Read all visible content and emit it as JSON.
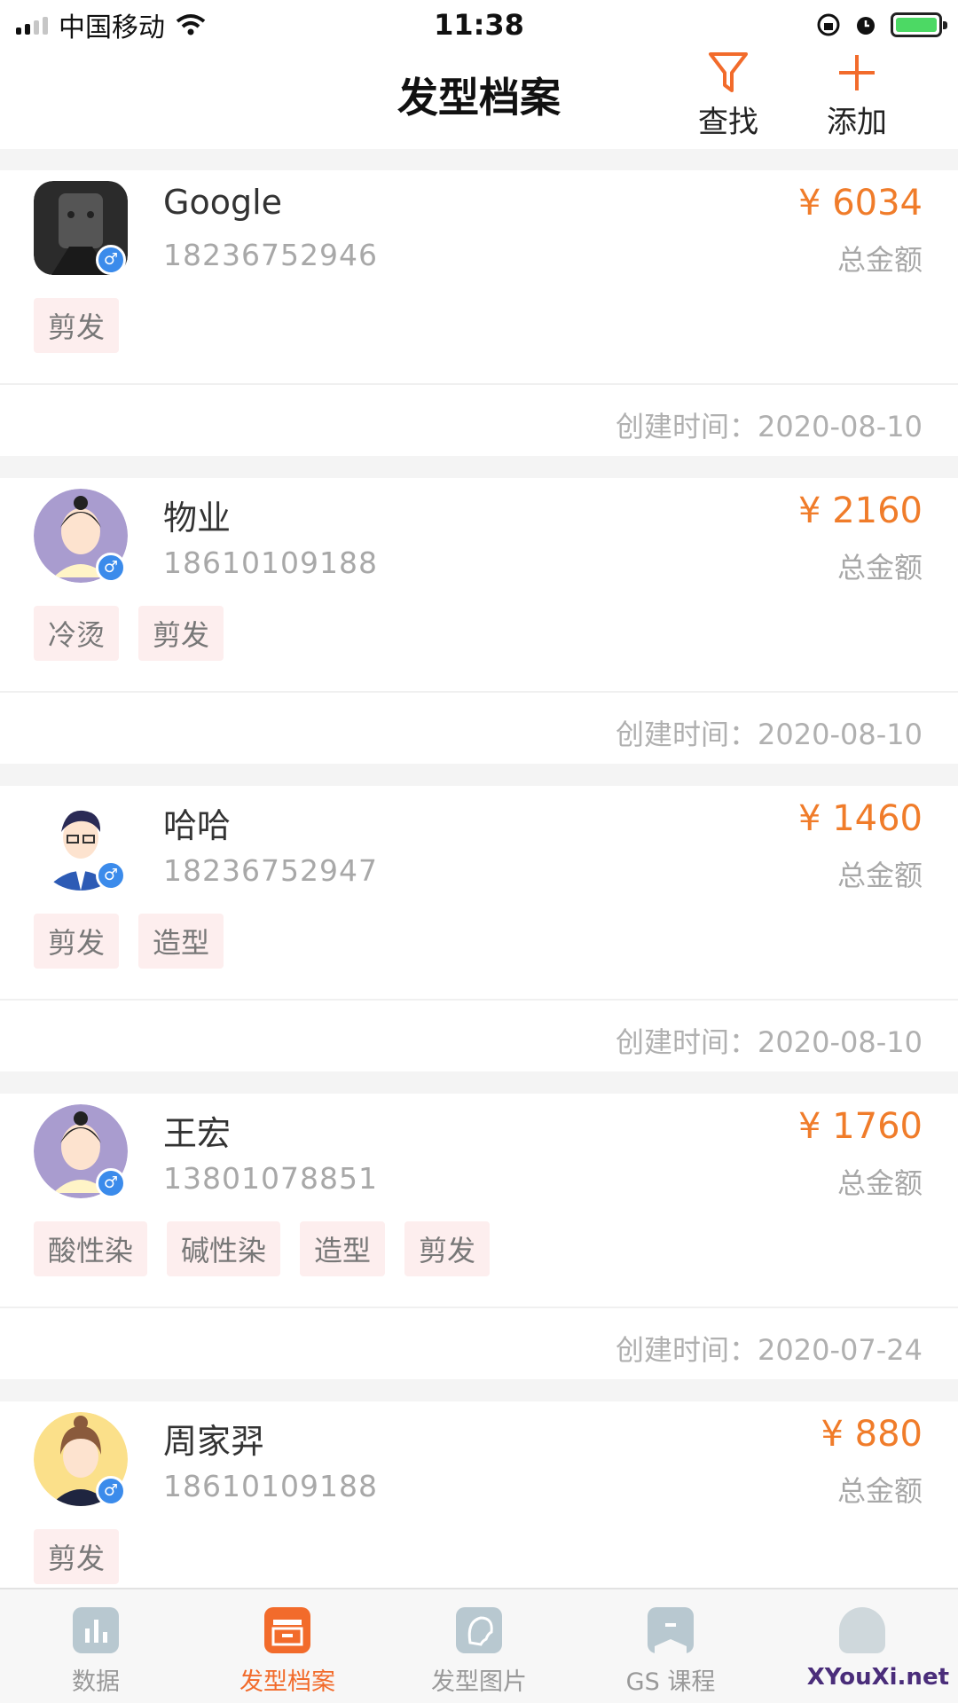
{
  "status": {
    "carrier": "中国移动",
    "time": "11:38"
  },
  "header": {
    "title": "发型档案",
    "find_label": "查找",
    "add_label": "添加"
  },
  "records": [
    {
      "name": "Google",
      "phone": "18236752946",
      "amount": "¥ 6034",
      "amount_label": "总金额",
      "tags": [
        "剪发"
      ],
      "created": "创建时间：2020-08-10"
    },
    {
      "name": "物业",
      "phone": "18610109188",
      "amount": "¥ 2160",
      "amount_label": "总金额",
      "tags": [
        "冷烫",
        "剪发"
      ],
      "created": "创建时间：2020-08-10"
    },
    {
      "name": "哈哈",
      "phone": "18236752947",
      "amount": "¥ 1460",
      "amount_label": "总金额",
      "tags": [
        "剪发",
        "造型"
      ],
      "created": "创建时间：2020-08-10"
    },
    {
      "name": "王宏",
      "phone": "13801078851",
      "amount": "¥ 1760",
      "amount_label": "总金额",
      "tags": [
        "酸性染",
        "碱性染",
        "造型",
        "剪发"
      ],
      "created": "创建时间：2020-07-24"
    },
    {
      "name": "周家羿",
      "phone": "18610109188",
      "amount": "¥ 880",
      "amount_label": "总金额",
      "tags": [
        "剪发"
      ],
      "created": ""
    }
  ],
  "tabs": [
    {
      "label": "数据"
    },
    {
      "label": "发型档案"
    },
    {
      "label": "发型图片"
    },
    {
      "label": "GS 课程"
    },
    {
      "label": ""
    }
  ],
  "watermark": "XYouXi.net",
  "colors": {
    "accent": "#f26b2b",
    "amount": "#f07c2a",
    "tag_bg": "#fdeeee",
    "badge": "#3b8beb"
  }
}
